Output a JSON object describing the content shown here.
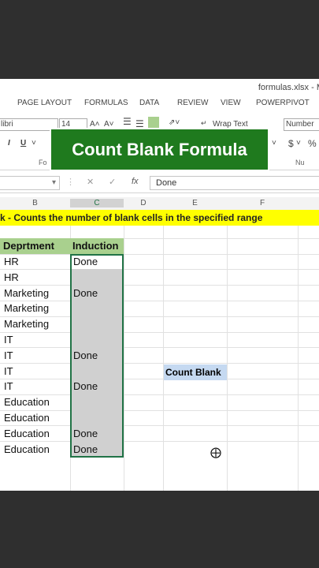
{
  "window": {
    "title": "formulas.xlsx - M"
  },
  "tabs": [
    "PAGE LAYOUT",
    "FORMULAS",
    "DATA",
    "REVIEW",
    "VIEW",
    "POWERPIVOT"
  ],
  "ribbon": {
    "font_name": "libri",
    "font_size": "14",
    "grow_font": "A˄",
    "shrink_font": "A˅",
    "italic": "I",
    "underline": "U",
    "wrap_text": "Wrap Text",
    "number_format": "Number",
    "currency": "$",
    "percent": "%",
    "font_group": "Fo",
    "number_group": "Nu"
  },
  "banner": {
    "text": "Count Blank Formula"
  },
  "formula_bar": {
    "fx": "fx",
    "value": "Done",
    "cancel": "✕",
    "enter": "✓"
  },
  "columns": [
    "B",
    "C",
    "D",
    "E",
    "F"
  ],
  "description": "k - Counts the number of blank cells in the specified range",
  "table": {
    "headers": [
      "Deprtment",
      "Induction"
    ],
    "rows": [
      {
        "dept": "HR",
        "induction": "Done"
      },
      {
        "dept": "HR",
        "induction": ""
      },
      {
        "dept": "Marketing",
        "induction": "Done"
      },
      {
        "dept": "Marketing",
        "induction": ""
      },
      {
        "dept": "Marketing",
        "induction": ""
      },
      {
        "dept": "IT",
        "induction": ""
      },
      {
        "dept": "IT",
        "induction": "Done"
      },
      {
        "dept": "IT",
        "induction": ""
      },
      {
        "dept": "IT",
        "induction": "Done"
      },
      {
        "dept": "Education",
        "induction": ""
      },
      {
        "dept": "Education",
        "induction": ""
      },
      {
        "dept": "Education",
        "induction": "Done"
      },
      {
        "dept": "Education",
        "induction": "Done"
      }
    ]
  },
  "count_blank_label": "Count Blank",
  "colors": {
    "banner": "#1f7a1e",
    "header_fill": "#a9d08e",
    "highlight": "#ffff00",
    "label_fill": "#c5d9f1",
    "selection_border": "#217346"
  }
}
